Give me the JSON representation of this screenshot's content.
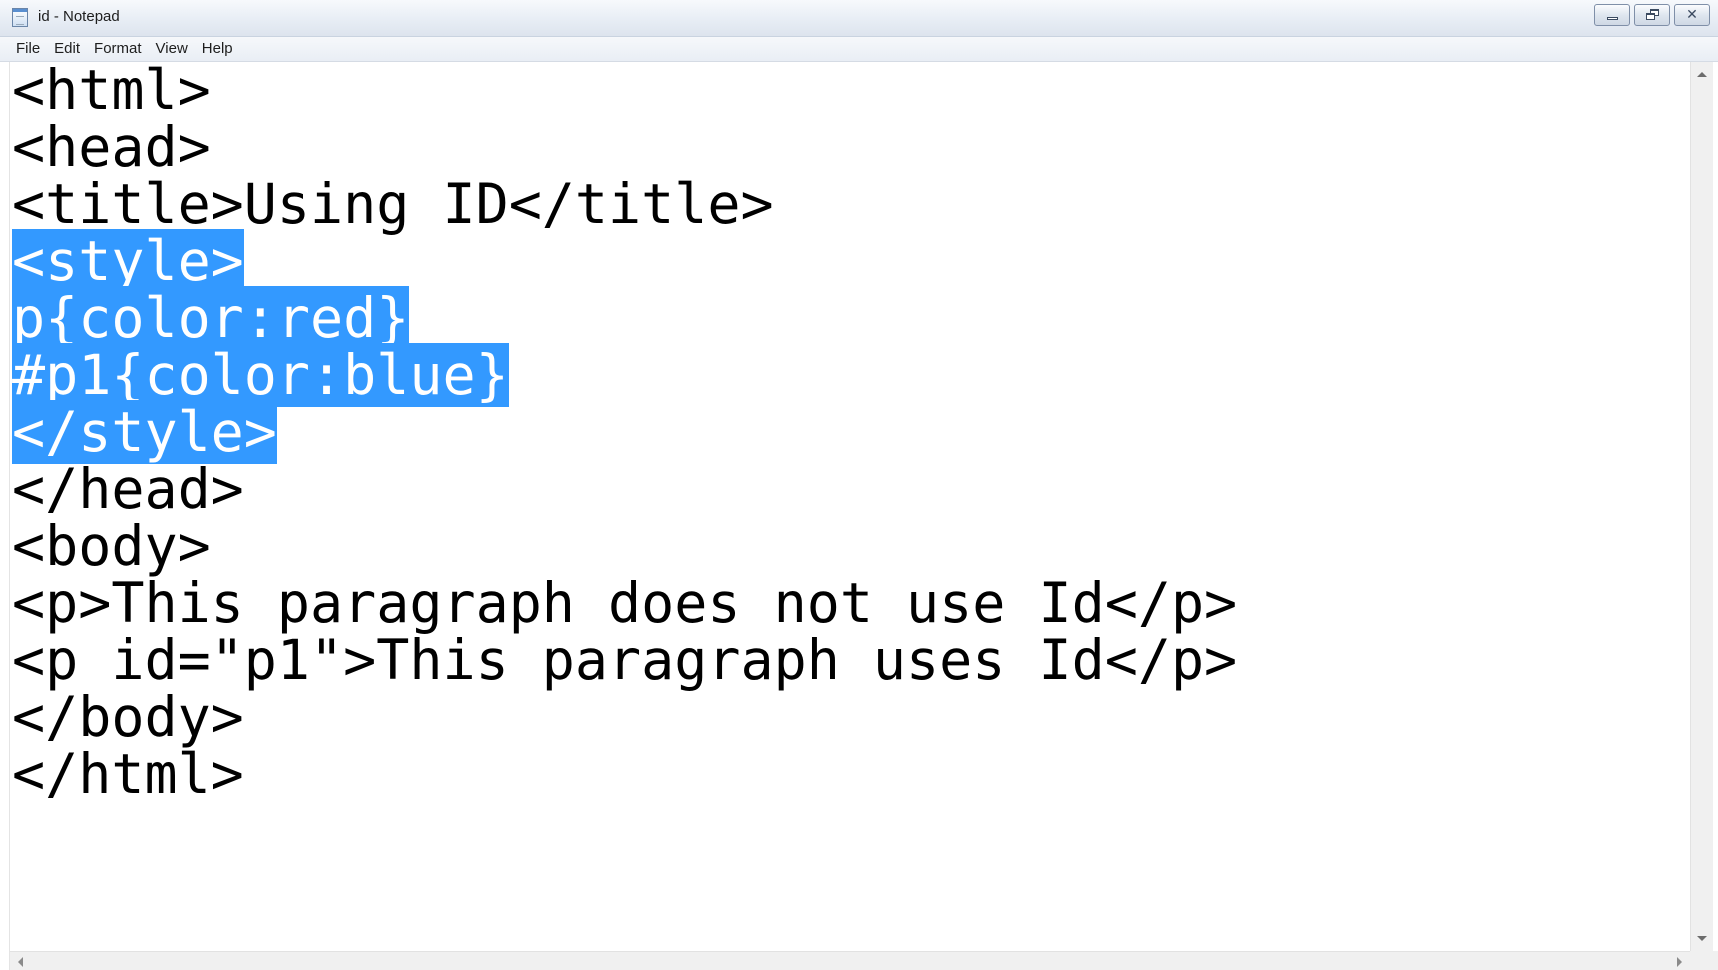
{
  "window": {
    "title": "id - Notepad"
  },
  "menu": {
    "items": [
      "File",
      "Edit",
      "Format",
      "View",
      "Help"
    ]
  },
  "editor": {
    "lines": [
      "<html>",
      "<head>",
      "<title>Using ID</title>",
      "<style>",
      "p{color:red}",
      "#p1{color:blue}",
      "</style>",
      "</head>",
      "<body>",
      "<p>This paragraph does not use Id</p>",
      "<p id=\"p1\">This paragraph uses Id</p>",
      "</body>",
      "</html>"
    ],
    "selected_lines": [
      3,
      4,
      5,
      6
    ],
    "selection_color": "#3399ff",
    "text_color": "#000000"
  },
  "icons": {
    "app": "notepad-icon",
    "minimize": "minimize-icon",
    "maximize": "restore-icon",
    "close": "close-icon",
    "close_glyph": "✕"
  }
}
